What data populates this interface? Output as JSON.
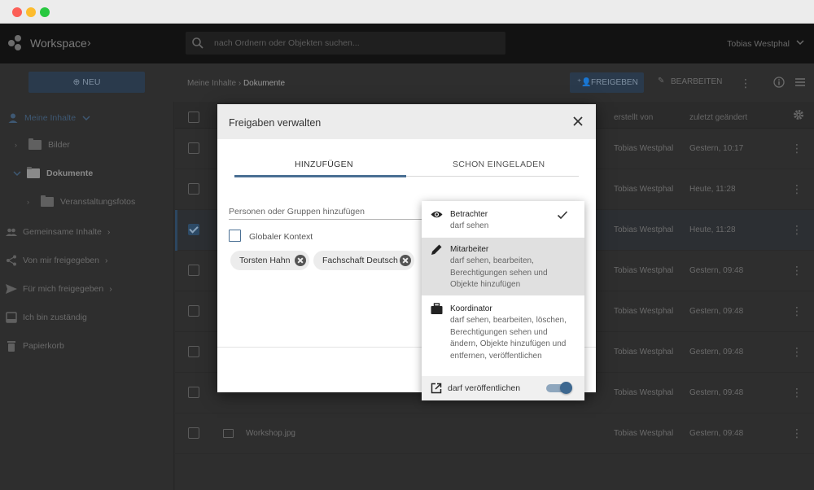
{
  "app": {
    "brand": "Workspace",
    "user": "Tobias Westphal"
  },
  "search": {
    "placeholder": "nach Ordnern oder Objekten suchen..."
  },
  "toolbar": {
    "new_label": "NEU",
    "breadcrumb": [
      "Meine Inhalte",
      "Dokumente"
    ],
    "share_label": "FREIGEBEN",
    "edit_label": "BEARBEITEN"
  },
  "sidebar": {
    "items": [
      {
        "label": "Meine Inhalte",
        "icon": "person-icon"
      },
      {
        "label": "Bilder",
        "icon": "folder-icon"
      },
      {
        "label": "Dokumente",
        "icon": "folder-icon"
      },
      {
        "label": "Veranstaltungsfotos",
        "icon": "folder-icon"
      },
      {
        "label": "Gemeinsame Inhalte",
        "icon": "group-icon"
      },
      {
        "label": "Von mir freigegeben",
        "icon": "share-icon"
      },
      {
        "label": "Für mich freigegeben",
        "icon": "send-icon"
      },
      {
        "label": "Ich bin zuständig",
        "icon": "inbox-icon"
      },
      {
        "label": "Papierkorb",
        "icon": "trash-icon"
      }
    ]
  },
  "list": {
    "headers": {
      "created_by": "erstellt von",
      "modified": "zuletzt geändert"
    },
    "rows": [
      {
        "name": "",
        "created_by": "Tobias Westphal",
        "modified": "Gestern, 10:17",
        "checked": false
      },
      {
        "name": "",
        "created_by": "Tobias Westphal",
        "modified": "Heute, 11:28",
        "checked": false
      },
      {
        "name": "",
        "created_by": "Tobias Westphal",
        "modified": "Heute, 11:28",
        "checked": true
      },
      {
        "name": "",
        "created_by": "Tobias Westphal",
        "modified": "Gestern, 09:48",
        "checked": false
      },
      {
        "name": "",
        "created_by": "Tobias Westphal",
        "modified": "Gestern, 09:48",
        "checked": false
      },
      {
        "name": "",
        "created_by": "Tobias Westphal",
        "modified": "Gestern, 09:48",
        "checked": false
      },
      {
        "name": "",
        "created_by": "Tobias Westphal",
        "modified": "Gestern, 09:48",
        "checked": false
      },
      {
        "name": "Workshop.jpg",
        "created_by": "Tobias Westphal",
        "modified": "Gestern, 09:48",
        "checked": false
      }
    ]
  },
  "modal": {
    "title": "Freigaben verwalten",
    "tabs": [
      "HINZUFÜGEN",
      "SCHON EINGELADEN"
    ],
    "field_placeholder": "Personen oder Gruppen hinzufügen",
    "global_context": "Globaler Kontext",
    "chips": [
      "Torsten Hahn",
      "Fachschaft Deutsch"
    ]
  },
  "roles": {
    "options": [
      {
        "title": "Betrachter",
        "desc": "darf sehen",
        "icon": "eye-icon",
        "selected": true
      },
      {
        "title": "Mitarbeiter",
        "desc": "darf sehen, bearbeiten, Berechtigungen sehen und Objekte hinzufügen",
        "icon": "pencil-icon",
        "selected": false
      },
      {
        "title": "Koordinator",
        "desc": "darf sehen, bearbeiten, löschen, Berechtigungen sehen und ändern, Objekte hinzufügen und entfernen, veröffentlichen",
        "icon": "briefcase-icon",
        "selected": false
      }
    ],
    "publish_label": "darf veröffentlichen",
    "publish_enabled": true
  },
  "colors": {
    "accent": "#4a6f93",
    "overlay_bg": "#2e2e2e"
  }
}
